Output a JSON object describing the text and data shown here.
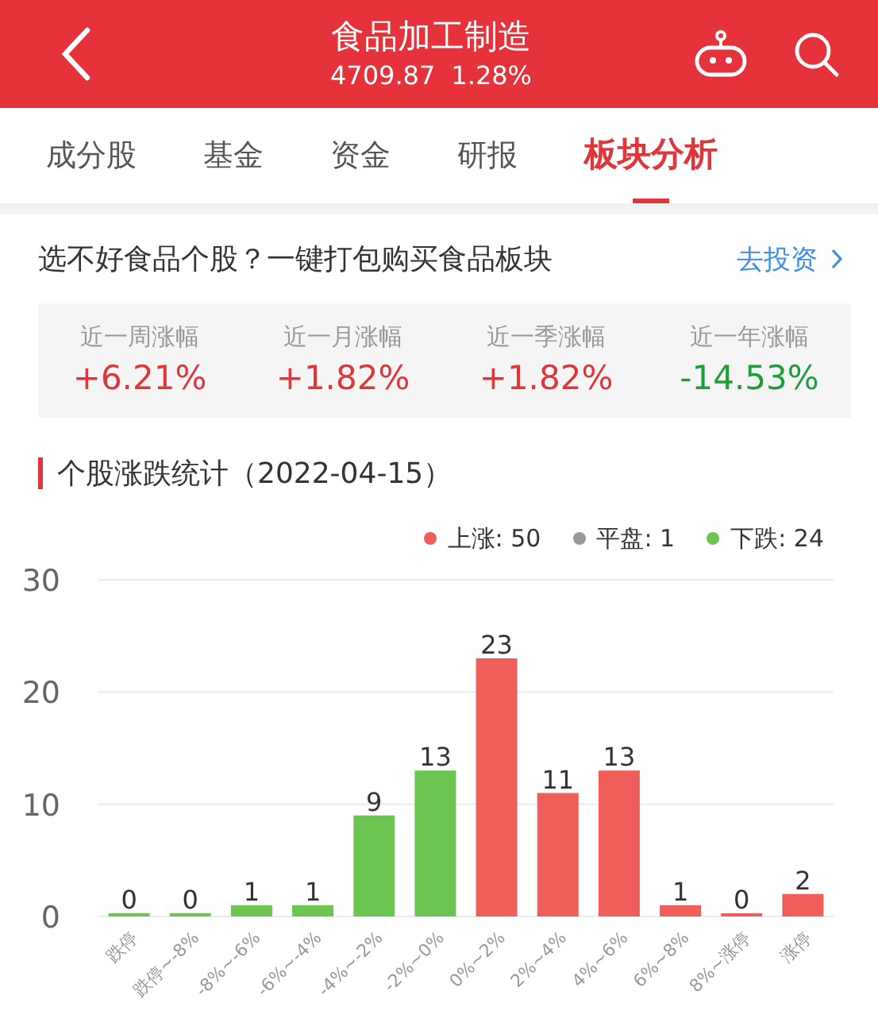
{
  "header": {
    "title": "食品加工制造",
    "price": "4709.87",
    "change": "1.28%"
  },
  "tabs": [
    {
      "label": "成分股",
      "selected": false
    },
    {
      "label": "基金",
      "selected": false
    },
    {
      "label": "资金",
      "selected": false
    },
    {
      "label": "研报",
      "selected": false
    },
    {
      "label": "板块分析",
      "selected": true
    }
  ],
  "promo": {
    "text": "选不好食品个股？一键打包购买食品板块",
    "link": "去投资"
  },
  "stats": [
    {
      "label": "近一周涨幅",
      "value": "+6.21%",
      "color": "#e0363a"
    },
    {
      "label": "近一月涨幅",
      "value": "+1.82%",
      "color": "#e0363a"
    },
    {
      "label": "近一季涨幅",
      "value": "+1.82%",
      "color": "#e0363a"
    },
    {
      "label": "近一年涨幅",
      "value": "-14.53%",
      "color": "#1e9e3a"
    }
  ],
  "section_title": "个股涨跌统计（2022-04-15）",
  "legend": [
    {
      "label": "上涨: 50",
      "color": "#ef5e5a"
    },
    {
      "label": "平盘: 1",
      "color": "#999999"
    },
    {
      "label": "下跌: 24",
      "color": "#6cc551"
    }
  ],
  "chart_data": {
    "type": "bar",
    "categories": [
      "跌停",
      "跌停~-8%",
      "-8%~-6%",
      "-6%~-4%",
      "-4%~-2%",
      "-2%~0%",
      "0%~2%",
      "2%~4%",
      "4%~6%",
      "6%~8%",
      "8%~涨停",
      "涨停"
    ],
    "series": [
      {
        "color": "#6cc551",
        "values": [
          0,
          0,
          1,
          1,
          9,
          13,
          null,
          null,
          null,
          null,
          null,
          null
        ]
      },
      {
        "color": "#ef5e5a",
        "values": [
          null,
          null,
          null,
          null,
          null,
          null,
          23,
          11,
          13,
          1,
          0,
          2
        ]
      }
    ],
    "ylim": [
      0,
      30
    ],
    "yticks": [
      0,
      10,
      20,
      30
    ],
    "data_labels": true
  }
}
